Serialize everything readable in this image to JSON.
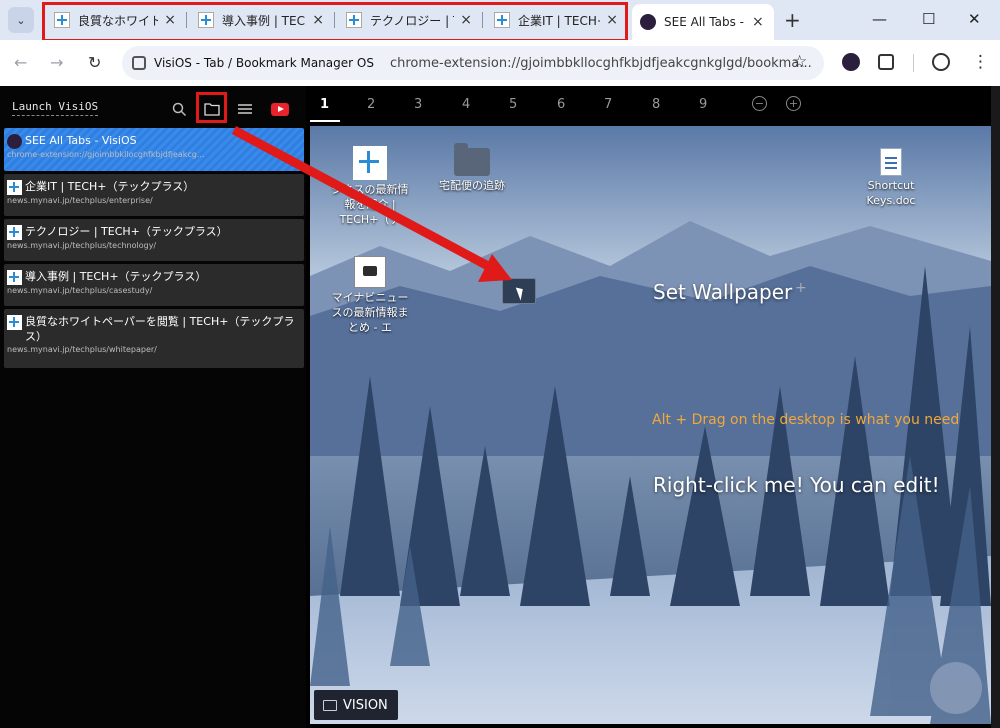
{
  "browser": {
    "tabs": [
      {
        "title": "良質なホワイトペ",
        "active": false
      },
      {
        "title": "導入事例 | TECH",
        "active": false
      },
      {
        "title": "テクノロジー | TE",
        "active": false
      },
      {
        "title": "企業IT | TECH+",
        "active": false
      },
      {
        "title": "SEE All Tabs - V",
        "active": true
      }
    ],
    "new_tab": "+",
    "window_controls": {
      "minimize": "—",
      "maximize": "☐",
      "close": "✕"
    }
  },
  "toolbar": {
    "back": "←",
    "forward": "→",
    "reload": "↻",
    "site_label": "VisiOS - Tab / Bookmark Manager OS",
    "url": "chrome-extension://gjoimbbkllocghfkbjdfjeakcgnkglgd/bookma...",
    "star": "☆",
    "menu": "⋮"
  },
  "sidebar": {
    "launch_label": "Launch VisiOS",
    "items": [
      {
        "title": "SEE All Tabs - VisiOS",
        "url": "chrome-extension://gjoimbbkllocghfkbjdfjeakcg...",
        "active": true
      },
      {
        "title": "企業IT | TECH+（テックプラス）",
        "url": "news.mynavi.jp/techplus/enterprise/"
      },
      {
        "title": "テクノロジー | TECH+（テックプラス）",
        "url": "news.mynavi.jp/techplus/technology/"
      },
      {
        "title": "導入事例 | TECH+（テックプラス）",
        "url": "news.mynavi.jp/techplus/casestudy/"
      },
      {
        "title": "良質なホワイトペーパーを閲覧 | TECH+（テックプラス）",
        "url": "news.mynavi.jp/techplus/whitepaper/"
      }
    ]
  },
  "pages": {
    "numbers": [
      "1",
      "2",
      "3",
      "4",
      "5",
      "6",
      "7",
      "8",
      "9"
    ],
    "current": "1",
    "zoom_out": "−",
    "zoom_in": "+"
  },
  "desktop": {
    "icons": {
      "tech_news": "ジネスの最新情報を紹介 | TECH+（テ",
      "folder": "宅配便の追跡",
      "shortcut": "Shortcut Keys.doc",
      "mynavi": "マイナビニュースの最新情報まとめ - エ"
    },
    "set_wallpaper": "Set Wallpaper",
    "plus": "+",
    "alt_drag_hint": "Alt + Drag on the desktop is what you need",
    "right_click_hint": "Right-click me! You can edit!",
    "vision_label": "VISION"
  },
  "colors": {
    "accent_red": "#e01919",
    "active_item_blue": "#2f7fe0",
    "hint_orange": "#f1a838"
  }
}
